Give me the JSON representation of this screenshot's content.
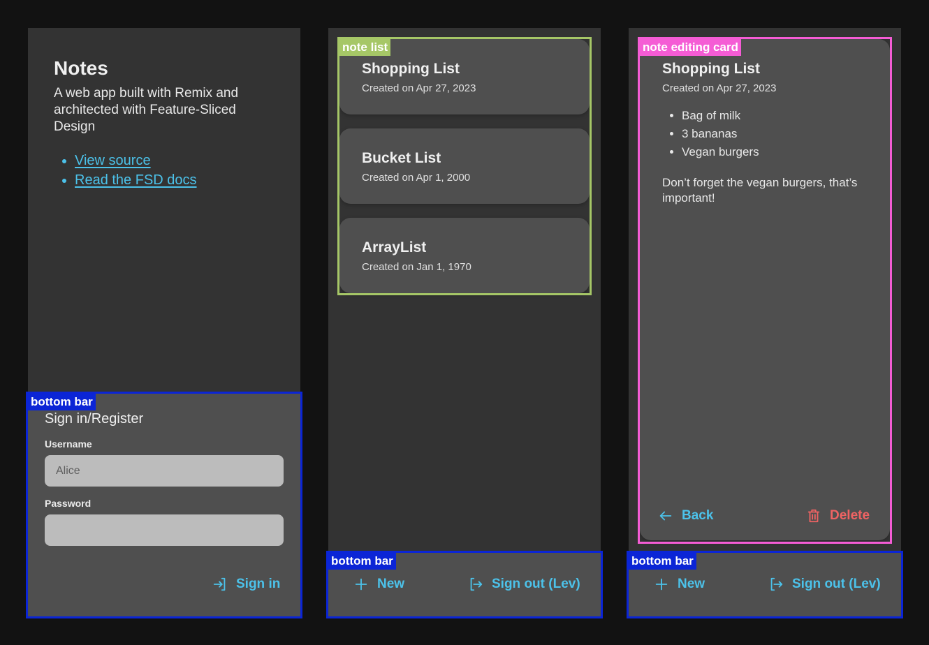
{
  "screen_home": {
    "title": "Notes",
    "description": "A web app built with Remix and architected with Feature-Sliced Design",
    "links": [
      {
        "label": "View source"
      },
      {
        "label": "Read the FSD docs"
      }
    ],
    "signin": {
      "heading": "Sign in/Register",
      "username_label": "Username",
      "username_placeholder": "Alice",
      "password_label": "Password",
      "password_placeholder": "",
      "submit_label": "Sign in",
      "submit_icon": "sign-in-icon"
    }
  },
  "screen_list": {
    "notes": [
      {
        "title": "Shopping List",
        "date": "Created on Apr 27, 2023"
      },
      {
        "title": "Bucket List",
        "date": "Created on Apr 1, 2000"
      },
      {
        "title": "ArrayList",
        "date": "Created on Jan 1, 1970"
      }
    ]
  },
  "screen_edit": {
    "title": "Shopping List",
    "date": "Created on Apr 27, 2023",
    "items": [
      "Bag of milk",
      "3 bananas",
      "Vegan burgers"
    ],
    "body": "Don’t forget the vegan burgers, that’s important!",
    "back_label": "Back",
    "back_icon": "arrow-left-icon",
    "delete_label": "Delete",
    "delete_icon": "trash-icon"
  },
  "bottom_bar": {
    "new_label": "New",
    "new_icon": "plus-icon",
    "signout_label": "Sign out (Lev)",
    "signout_icon": "sign-out-icon"
  },
  "annotations": {
    "bottom_bar": "bottom bar",
    "note_list": "note list",
    "note_editing_card": "note editing card"
  },
  "colors": {
    "background": "#121212",
    "screen": "#333333",
    "surface": "#4f4f4f",
    "accent": "#4cc2ea",
    "danger": "#ef6363",
    "annotation_blue": "#0b25d6",
    "annotation_green": "#a6c767",
    "annotation_pink": "#f55cd5"
  }
}
